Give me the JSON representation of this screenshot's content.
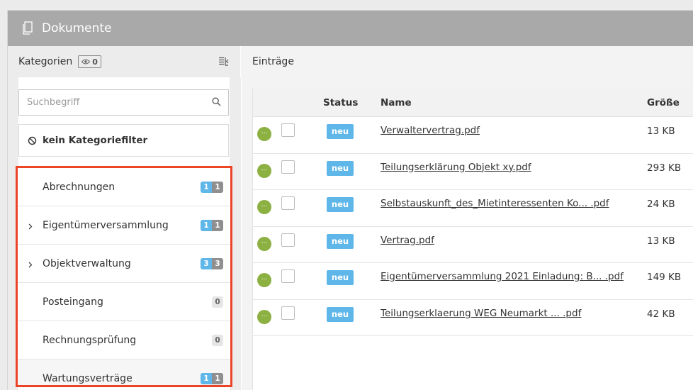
{
  "panel": {
    "title": "Dokumente"
  },
  "categories": {
    "header": "Kategorien",
    "visible_count": "0",
    "search_placeholder": "Suchbegriff",
    "no_filter_label": "kein Kategoriefilter",
    "items": [
      {
        "label": "Abrechnungen",
        "expandable": false,
        "new": "1",
        "total": "1"
      },
      {
        "label": "Eigentümerversammlung",
        "expandable": true,
        "new": "1",
        "total": "1"
      },
      {
        "label": "Objektverwaltung",
        "expandable": true,
        "new": "3",
        "total": "3"
      },
      {
        "label": "Posteingang",
        "expandable": false,
        "total": "0"
      },
      {
        "label": "Rechnungsprüfung",
        "expandable": false,
        "total": "0"
      },
      {
        "label": "Wartungsverträge",
        "expandable": false,
        "new": "1",
        "total": "1"
      }
    ]
  },
  "entries": {
    "header": "Einträge",
    "columns": {
      "status": "Status",
      "name": "Name",
      "size": "Größe"
    },
    "rows": [
      {
        "indicator": "...",
        "status": "neu",
        "name": "Verwaltervertrag.pdf",
        "size": "13 KB"
      },
      {
        "indicator": "...",
        "status": "neu",
        "name": "Teilungserklärung Objekt xy.pdf",
        "size": "293 KB"
      },
      {
        "indicator": "...",
        "status": "neu",
        "name": "Selbstauskunft_des_Mietinteressenten Ko... .pdf",
        "size": "24 KB"
      },
      {
        "indicator": "...",
        "status": "neu",
        "name": "Vertrag.pdf",
        "size": "13 KB"
      },
      {
        "indicator": "...",
        "status": "neu",
        "name": "Eigentümerversammlung 2021 Einladung: B... .pdf",
        "size": "149 KB"
      },
      {
        "indicator": "...",
        "status": "neu",
        "name": "Teilungserklaerung WEG Neumarkt ... .pdf",
        "size": "42 KB"
      }
    ]
  },
  "colors": {
    "accent_blue": "#5eb6e9",
    "highlight_red": "#ec4427",
    "status_green": "#8cb142",
    "titlebar": "#a9a9a9"
  },
  "icons": {
    "title": "document-icon",
    "visibility": "eye-icon",
    "collapse": "collapse-panel-icon",
    "search": "search-icon",
    "no_filter": "prohibited-icon",
    "expand": "chevron-right-icon"
  }
}
